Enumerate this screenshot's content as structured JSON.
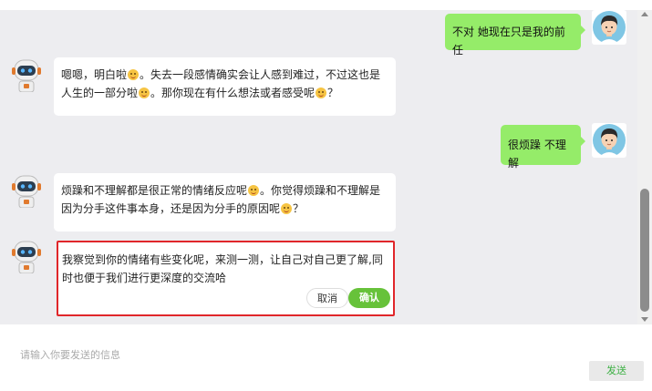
{
  "messages": [
    {
      "role": "user",
      "text": "不对 她现在只是我的前任"
    },
    {
      "role": "bot",
      "line1_a": "嗯嗯，明白啦",
      "line1_b": "。失去一段感情确实会让人感到难过，不过这也是",
      "line2_a": "人生的一部分啦",
      "line2_b": "。那你现在有什么想法或者感受呢",
      "line2_c": "？"
    },
    {
      "role": "user",
      "text": "很烦躁 不理解"
    },
    {
      "role": "bot",
      "line1_a": "烦躁和不理解都是很正常的情绪反应呢",
      "line1_b": "。你觉得烦躁和不理解是",
      "line2_a": "因为分手这件事本身，还是因为分手的原因呢",
      "line2_b": "？"
    },
    {
      "role": "bot",
      "text": "我察觉到你的情绪有些变化呢，来测一测，让自己对自己更了解,同时也便于我们进行更深度的交流哈"
    }
  ],
  "prompt_actions": {
    "cancel_label": "取消",
    "confirm_label": "确认"
  },
  "composer": {
    "placeholder": "请输入你要发送的信息",
    "value": "",
    "send_label": "发送"
  },
  "colors": {
    "user_bubble": "#95ec69",
    "bot_bubble": "#ffffff",
    "chat_bg": "#ededf0",
    "highlight_border": "#e0262a",
    "confirm": "#67c23a"
  },
  "icons": {
    "user_avatar": "cartoon-boy-avatar",
    "bot_avatar": "robot-avatar",
    "emoji": "smiley-emoji"
  }
}
